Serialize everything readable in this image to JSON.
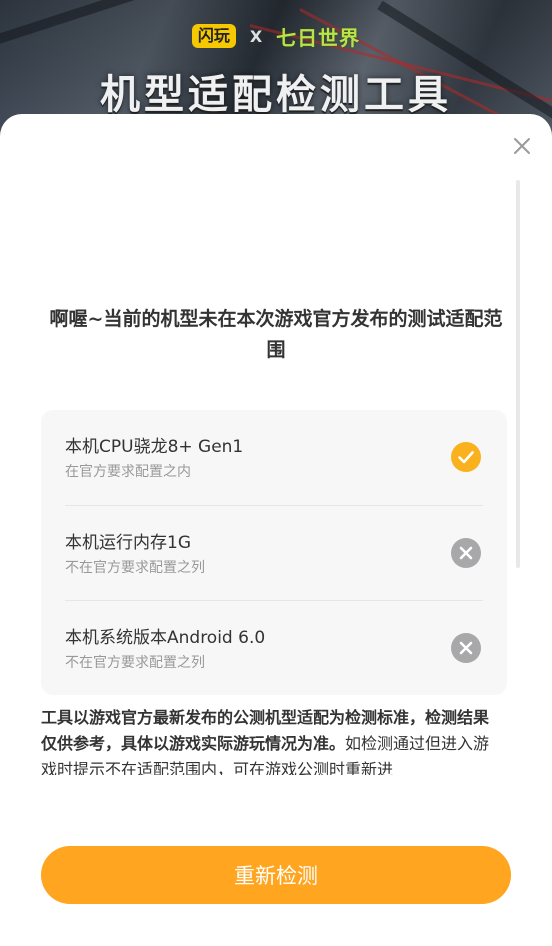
{
  "banner": {
    "logo_brand": "闪玩",
    "logo_separator": "X",
    "logo_game": "七日世界",
    "title": "机型适配检测工具"
  },
  "dialog": {
    "close_icon": "close-icon",
    "result_title": "啊喔~当前的机型未在本次游戏官方发布的测试适配范围",
    "checks": [
      {
        "title": "本机CPU骁龙8+ Gen1",
        "subtitle": "在官方要求配置之内",
        "status": "pass",
        "icon": "check-circle-icon",
        "color": "#f9b21d"
      },
      {
        "title": "本机运行内存1G",
        "subtitle": "不在官方要求配置之列",
        "status": "fail",
        "icon": "x-circle-icon",
        "color": "#a8a8aa"
      },
      {
        "title": "本机系统版本Android 6.0",
        "subtitle": "不在官方要求配置之列",
        "status": "fail",
        "icon": "x-circle-icon",
        "color": "#a8a8aa"
      }
    ],
    "note_bold": "工具以游戏官方最新发布的公测机型适配为检测标准，检测结果仅供参考，具体以游戏实际游玩情况为准。",
    "note_rest": "如检测通过但进入游戏时提示不在适配范围内，可在游戏公测时重新进",
    "retry_button": "重新检测",
    "accent_color": "#ffa51f"
  }
}
